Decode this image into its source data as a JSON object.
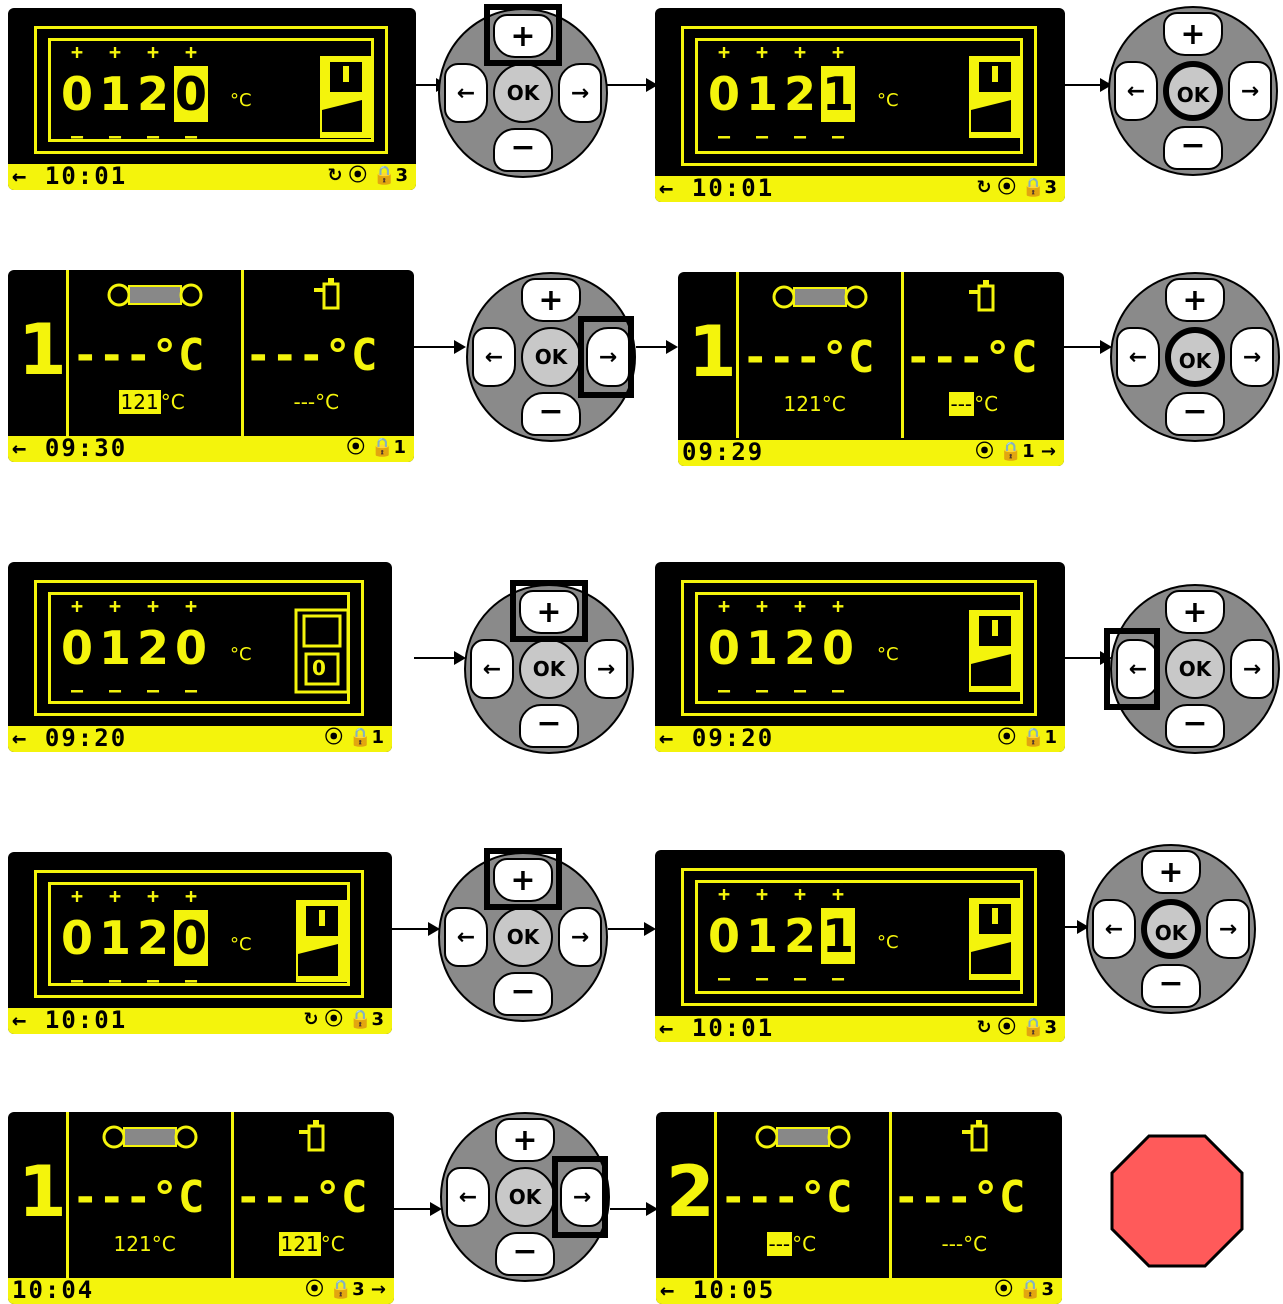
{
  "colors": {
    "lcd_bg": "#000000",
    "lcd_fg": "#f4f40c",
    "pad_ring": "#8a8a8a",
    "stop": "#ff5a5a"
  },
  "setpoint_screens": [
    {
      "id": "r1a",
      "digits": [
        "0",
        "1",
        "2",
        "0"
      ],
      "hl": 3,
      "unit": "°C",
      "time": "← 10:01",
      "icons": "↻ ⦿ 🔒3"
    },
    {
      "id": "r1b",
      "digits": [
        "0",
        "1",
        "2",
        "1"
      ],
      "hl": 3,
      "unit": "°C",
      "time": "← 10:01",
      "icons": "↻ ⦿ 🔒3"
    },
    {
      "id": "r3a",
      "digits": [
        "0",
        "1",
        "2",
        "0"
      ],
      "hl": -1,
      "unit": "°C",
      "time": "← 09:20",
      "icons": "⦿ 🔒1",
      "switch_label": "0"
    },
    {
      "id": "r3b",
      "digits": [
        "0",
        "1",
        "2",
        "0"
      ],
      "hl": -1,
      "unit": "°C",
      "time": "← 09:20",
      "icons": "⦿ 🔒1"
    },
    {
      "id": "r4a",
      "digits": [
        "0",
        "1",
        "2",
        "0"
      ],
      "hl": 3,
      "unit": "°C",
      "time": "← 10:01",
      "icons": "↻ ⦿ 🔒3"
    },
    {
      "id": "r4b",
      "digits": [
        "0",
        "1",
        "2",
        "1"
      ],
      "hl": 3,
      "unit": "°C",
      "time": "← 10:01",
      "icons": "↻ ⦿ 🔒3"
    }
  ],
  "status_screens": {
    "r2a": {
      "num": "1",
      "t1": "---°C",
      "t2": "---°C",
      "s1": "121",
      "s1u": "°C",
      "s1hl": true,
      "s2": "---",
      "s2u": "°C",
      "s2hl": false,
      "time": "← 09:30",
      "icons": "⦿ 🔒1"
    },
    "r2b": {
      "num": "1",
      "t1": "---°C",
      "t2": "---°C",
      "s1": "121",
      "s1u": "°C",
      "s1hl": false,
      "s2": "---",
      "s2u": "°C",
      "s2hl": true,
      "time": "09:29",
      "icons": "⦿ 🔒1 →"
    },
    "r5a": {
      "num": "1",
      "t1": "---°C",
      "t2": "---°C",
      "s1": "121",
      "s1u": "°C",
      "s1hl": false,
      "s2": "121",
      "s2u": "°C",
      "s2hl": true,
      "time": "10:04",
      "icons": "⦿ 🔒3 →"
    },
    "r5b": {
      "num": "2",
      "t1": "---°C",
      "t2": "---°C",
      "s1": "---",
      "s1u": "°C",
      "s1hl": true,
      "s2": "---",
      "s2u": "°C",
      "s2hl": false,
      "time": "← 10:05",
      "icons": "⦿ 🔒3"
    }
  },
  "keypad": {
    "up": "+",
    "down": "−",
    "left": "←",
    "right": "→",
    "ok": "OK"
  },
  "pm": {
    "plus": "+",
    "minus": "—"
  }
}
